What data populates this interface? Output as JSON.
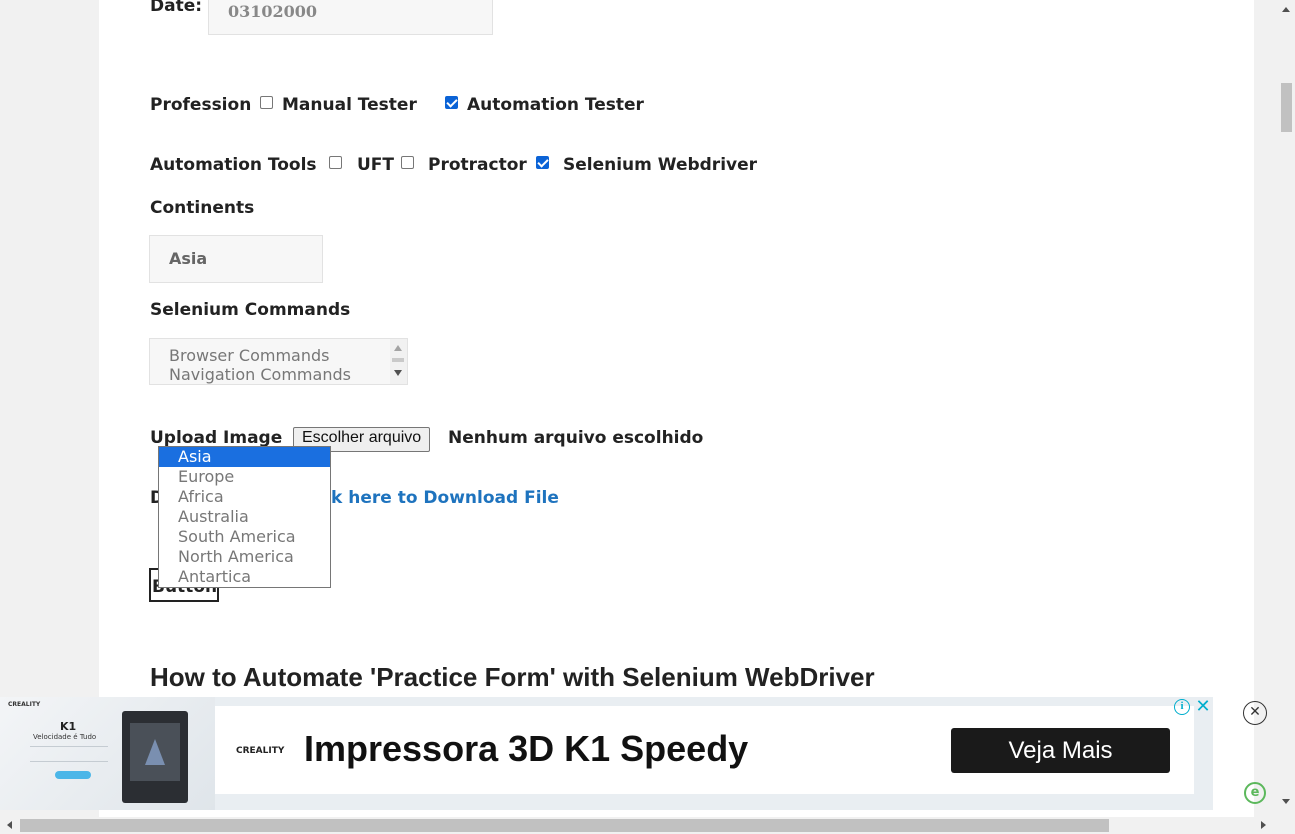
{
  "form": {
    "date_label": "Date:",
    "date_value": "03102000",
    "profession_label": "Profession",
    "profession_options": [
      "Manual Tester",
      "Automation Tester"
    ],
    "tools_label": "Automation Tools",
    "tools_options": [
      "UFT",
      "Protractor",
      "Selenium Webdriver"
    ],
    "continents_label": "Continents",
    "continents_selected": "Asia",
    "continents_options": [
      "Asia",
      "Europe",
      "Africa",
      "Australia",
      "South America",
      "North America",
      "Antartica"
    ],
    "commands_label": "Selenium Commands",
    "commands_options": [
      "Browser Commands",
      "Navigation Commands"
    ],
    "upload_label": "Upload Image",
    "upload_button": "Escolher arquivo",
    "upload_status": "Nenhum arquivo escolhido",
    "download_prefix": "D",
    "download_link": "k here to Download File",
    "button_label": "Button"
  },
  "article": {
    "heading": "How to Automate 'Practice Form' with Selenium WebDriver"
  },
  "ad": {
    "brand": "CREALITY",
    "thumb_title": "K1",
    "thumb_subtitle": "Velocidade é Tudo",
    "headline": "Impressora 3D K1 Speedy",
    "cta": "Veja Mais"
  },
  "colors": {
    "link": "#1e73be",
    "selected": "#1a6fe0",
    "checkbox": "#0b63d6"
  }
}
